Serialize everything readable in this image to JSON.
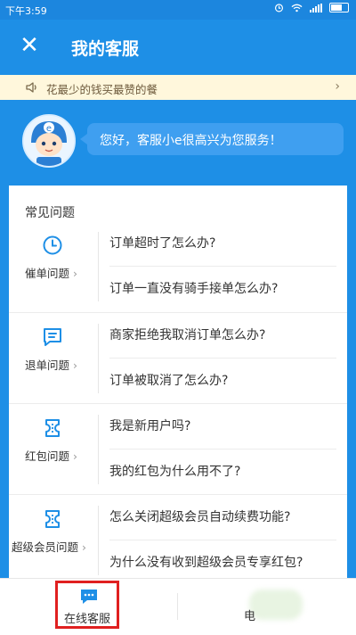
{
  "status_bar": {
    "time": "下午3:59"
  },
  "header": {
    "close_icon": "close-icon",
    "title": "我的客服"
  },
  "notice": {
    "icon": "speaker-icon",
    "text": "花最少的钱买最赞的餐",
    "chevron": "›"
  },
  "greeting": {
    "avatar": "mascot-avatar",
    "text": "您好，客服小e很高兴为您服务！"
  },
  "faq": {
    "title": "常见问题",
    "categories": [
      {
        "icon": "clock-icon",
        "label": "催单问题",
        "questions": [
          "订单超时了怎么办?",
          "订单一直没有骑手接单怎么办?"
        ]
      },
      {
        "icon": "receipt-icon",
        "label": "退单问题",
        "questions": [
          "商家拒绝我取消订单怎么办?",
          "订单被取消了怎么办?"
        ]
      },
      {
        "icon": "ticket-icon",
        "label": "红包问题",
        "questions": [
          "我是新用户吗?",
          "我的红包为什么用不了?"
        ]
      },
      {
        "icon": "ticket-icon",
        "label": "超级会员问题",
        "questions": [
          "怎么关闭超级会员自动续费功能?",
          "为什么没有收到超级会员专享红包?"
        ]
      }
    ],
    "chevron": "›"
  },
  "bottom_bar": {
    "online": {
      "icon": "chat-bubble-icon",
      "label": "在线客服"
    },
    "phone": {
      "label": "电"
    }
  },
  "colors": {
    "accent": "#1e8fe6",
    "highlight_border": "#e02020",
    "notice_bg": "#fff7dc"
  }
}
